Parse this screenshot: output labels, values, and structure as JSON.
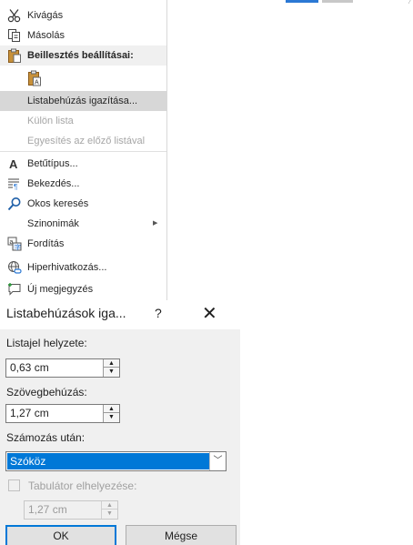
{
  "context_menu": {
    "items_top": [
      {
        "label": "Kivágás",
        "icon": "scissors-icon"
      },
      {
        "label": "Másolás",
        "icon": "copy-icon"
      }
    ],
    "paste_header": "Beillesztés beállításai:",
    "paste_option_icon": "paste-keep-text-icon",
    "list_items": [
      {
        "label": "Listabehúzás igazítása...",
        "state": "highlighted"
      },
      {
        "label": "Külön lista",
        "state": "disabled"
      },
      {
        "label": "Egyesítés az előző listával",
        "state": "disabled"
      }
    ],
    "items_bottom": [
      {
        "label": "Betűtípus...",
        "icon": "font-icon"
      },
      {
        "label": "Bekezdés...",
        "icon": "paragraph-icon"
      },
      {
        "label": "Okos keresés",
        "icon": "smart-lookup-icon"
      },
      {
        "label": "Szinonimák",
        "icon": "",
        "has_submenu": true
      },
      {
        "label": "Fordítás",
        "icon": "translate-icon"
      },
      {
        "label": "Hiperhivatkozás...",
        "icon": "hyperlink-icon"
      },
      {
        "label": "Új megjegyzés",
        "icon": "new-comment-icon"
      }
    ]
  },
  "dialog": {
    "title": "Listabehúzások iga...",
    "help": "?",
    "close": "✕",
    "bullet_position_label": "Listajel helyzete:",
    "bullet_position_value": "0,63 cm",
    "text_indent_label": "Szövegbehúzás:",
    "text_indent_value": "1,27 cm",
    "follow_number_label": "Számozás után:",
    "follow_number_value": "Szóköz",
    "tab_stop_label": "Tabulátor elhelyezése:",
    "tab_stop_checked": false,
    "tab_stop_value": "1,27 cm",
    "ok": "OK",
    "cancel": "Mégse",
    "accent_color": "#0078d7"
  }
}
